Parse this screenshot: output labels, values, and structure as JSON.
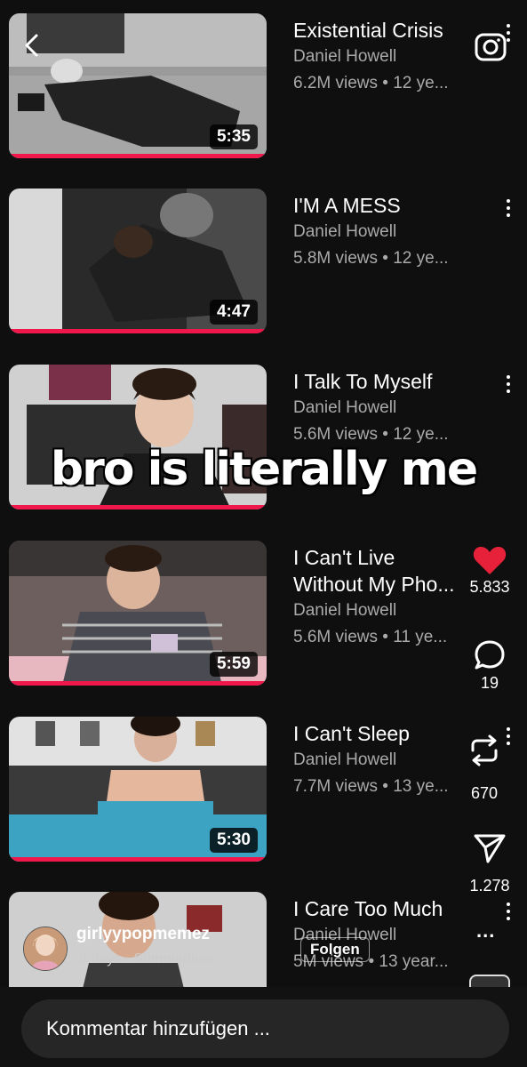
{
  "videos": [
    {
      "title": "Existential Crisis",
      "title2": "",
      "channel": "Daniel Howell",
      "meta": "6.2M views • 12 ye...",
      "duration": "5:35",
      "thumb_bg": "#8c8c8c"
    },
    {
      "title": "I'M A MESS",
      "title2": "",
      "channel": "Daniel Howell",
      "meta": "5.8M views • 12 ye...",
      "duration": "4:47",
      "thumb_bg": "#5a5a5a"
    },
    {
      "title": "I Talk To Myself",
      "title2": "",
      "channel": "Daniel Howell",
      "meta": "5.6M views • 12 ye...",
      "duration": "",
      "thumb_bg": "#6d6d6d"
    },
    {
      "title": "I Can't Live",
      "title2": "Without My Pho...",
      "channel": "Daniel Howell",
      "meta": "5.6M views • 11 ye...",
      "duration": "5:59",
      "thumb_bg": "#7a6e6e"
    },
    {
      "title": "I Can't Sleep",
      "title2": "",
      "channel": "Daniel Howell",
      "meta": "7.7M views • 13 ye...",
      "duration": "5:30",
      "thumb_bg": "#c9c9c9"
    },
    {
      "title": "I Care Too Much",
      "title2": "",
      "channel": "Daniel Howell",
      "meta": "5M views • 13 year...",
      "duration": "",
      "thumb_bg": "#9a8a80"
    }
  ],
  "overlay": {
    "caption": "bro is literally me"
  },
  "actions": {
    "likes": "5.833",
    "comments": "19",
    "reposts": "670",
    "shares": "1.278",
    "more": "..."
  },
  "author": {
    "name": "girlyypopmemez",
    "music": "♫ days · Summertime",
    "follow": "Folgen"
  },
  "comment_placeholder": "Kommentar hinzufügen ...",
  "colors": {
    "accent": "#f0174b",
    "like": "#e8213b",
    "background": "#0f0f0f"
  }
}
